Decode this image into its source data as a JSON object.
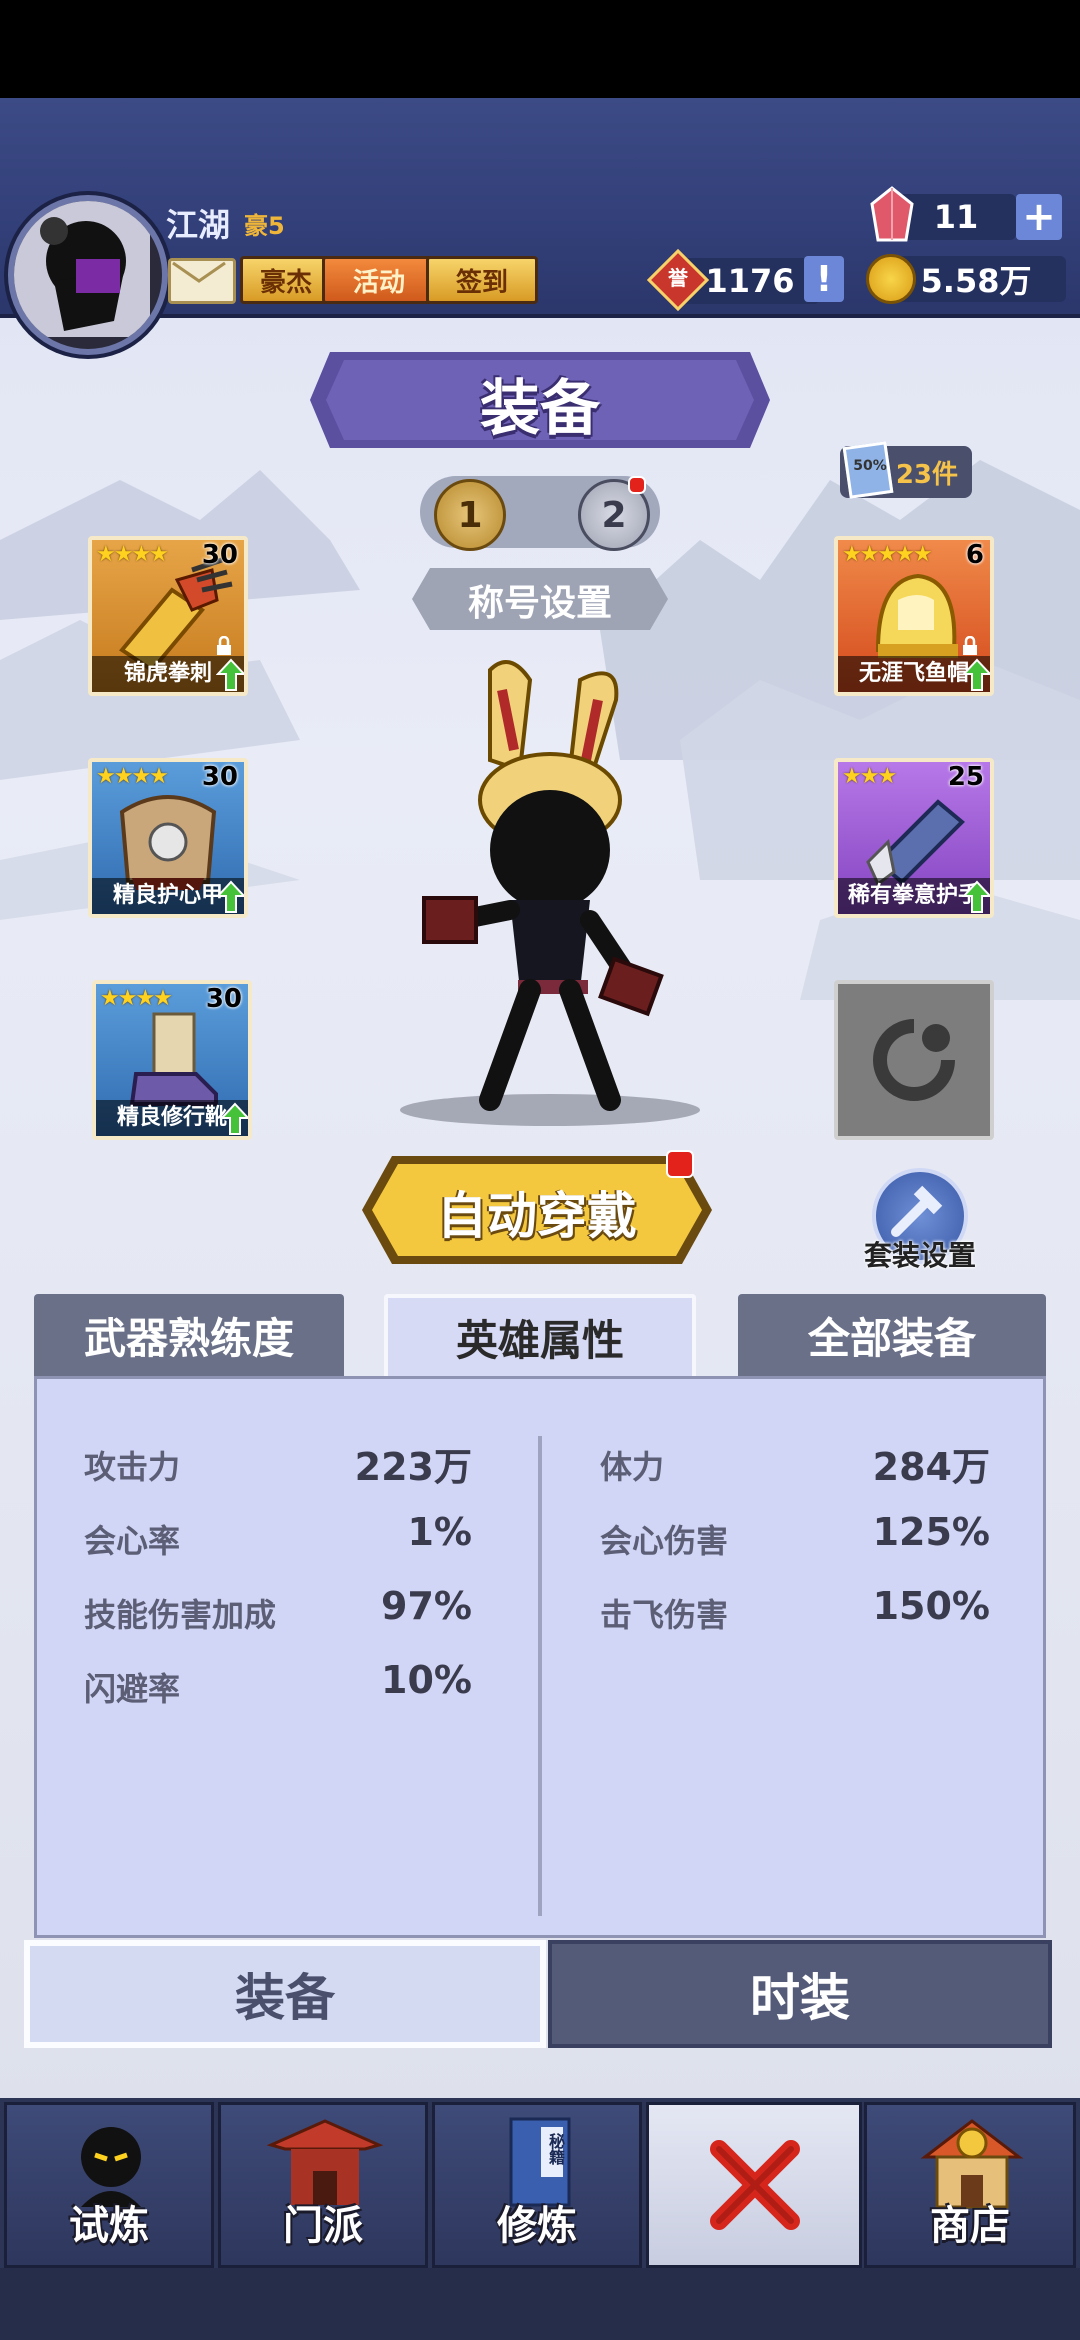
{
  "header": {
    "player_name": "江湖",
    "vip_label": "豪5",
    "buttons": [
      "豪杰",
      "活动",
      "签到"
    ],
    "gems": "11",
    "honor": "1176",
    "coins": "5.58万",
    "honor_glyph": "誉"
  },
  "title": "装备",
  "set_options": [
    "1",
    "2"
  ],
  "title_setting": "称号设置",
  "cards": {
    "count_label": "23件",
    "badge": "50%"
  },
  "left_slots": [
    {
      "stars": "★★★★",
      "level": "30",
      "name": "锦虎拳刺",
      "quality": "gold"
    },
    {
      "stars": "★★★★",
      "level": "30",
      "name": "精良护心甲",
      "quality": "blue"
    },
    {
      "stars": "★★★★",
      "level": "30",
      "name": "精良修行靴",
      "quality": "blue"
    }
  ],
  "right_slots": [
    {
      "stars": "★★★★★",
      "level": "6",
      "name": "无涯飞鱼帽",
      "quality": "red"
    },
    {
      "stars": "★★★",
      "level": "25",
      "name": "稀有拳意护手",
      "quality": "purple"
    }
  ],
  "auto_equip": "自动穿戴",
  "suit_setting": "套装设置",
  "tabs": [
    "武器熟练度",
    "英雄属性",
    "全部装备"
  ],
  "stats_left": [
    {
      "label": "攻击力",
      "value": "223万"
    },
    {
      "label": "会心率",
      "value": "1%"
    },
    {
      "label": "技能伤害加成",
      "value": "97%"
    },
    {
      "label": "闪避率",
      "value": "10%"
    }
  ],
  "stats_right": [
    {
      "label": "体力",
      "value": "284万"
    },
    {
      "label": "会心伤害",
      "value": "125%"
    },
    {
      "label": "击飞伤害",
      "value": "150%"
    }
  ],
  "lower_tabs": [
    "装备",
    "时装"
  ],
  "nav": [
    "试炼",
    "门派",
    "修炼",
    "",
    "商店"
  ],
  "nav_book_text": "秘籍",
  "colors": {
    "title_purple": "#5b4fa0",
    "tab_active": "#d6daf4",
    "panel": "#d2d6f6"
  }
}
